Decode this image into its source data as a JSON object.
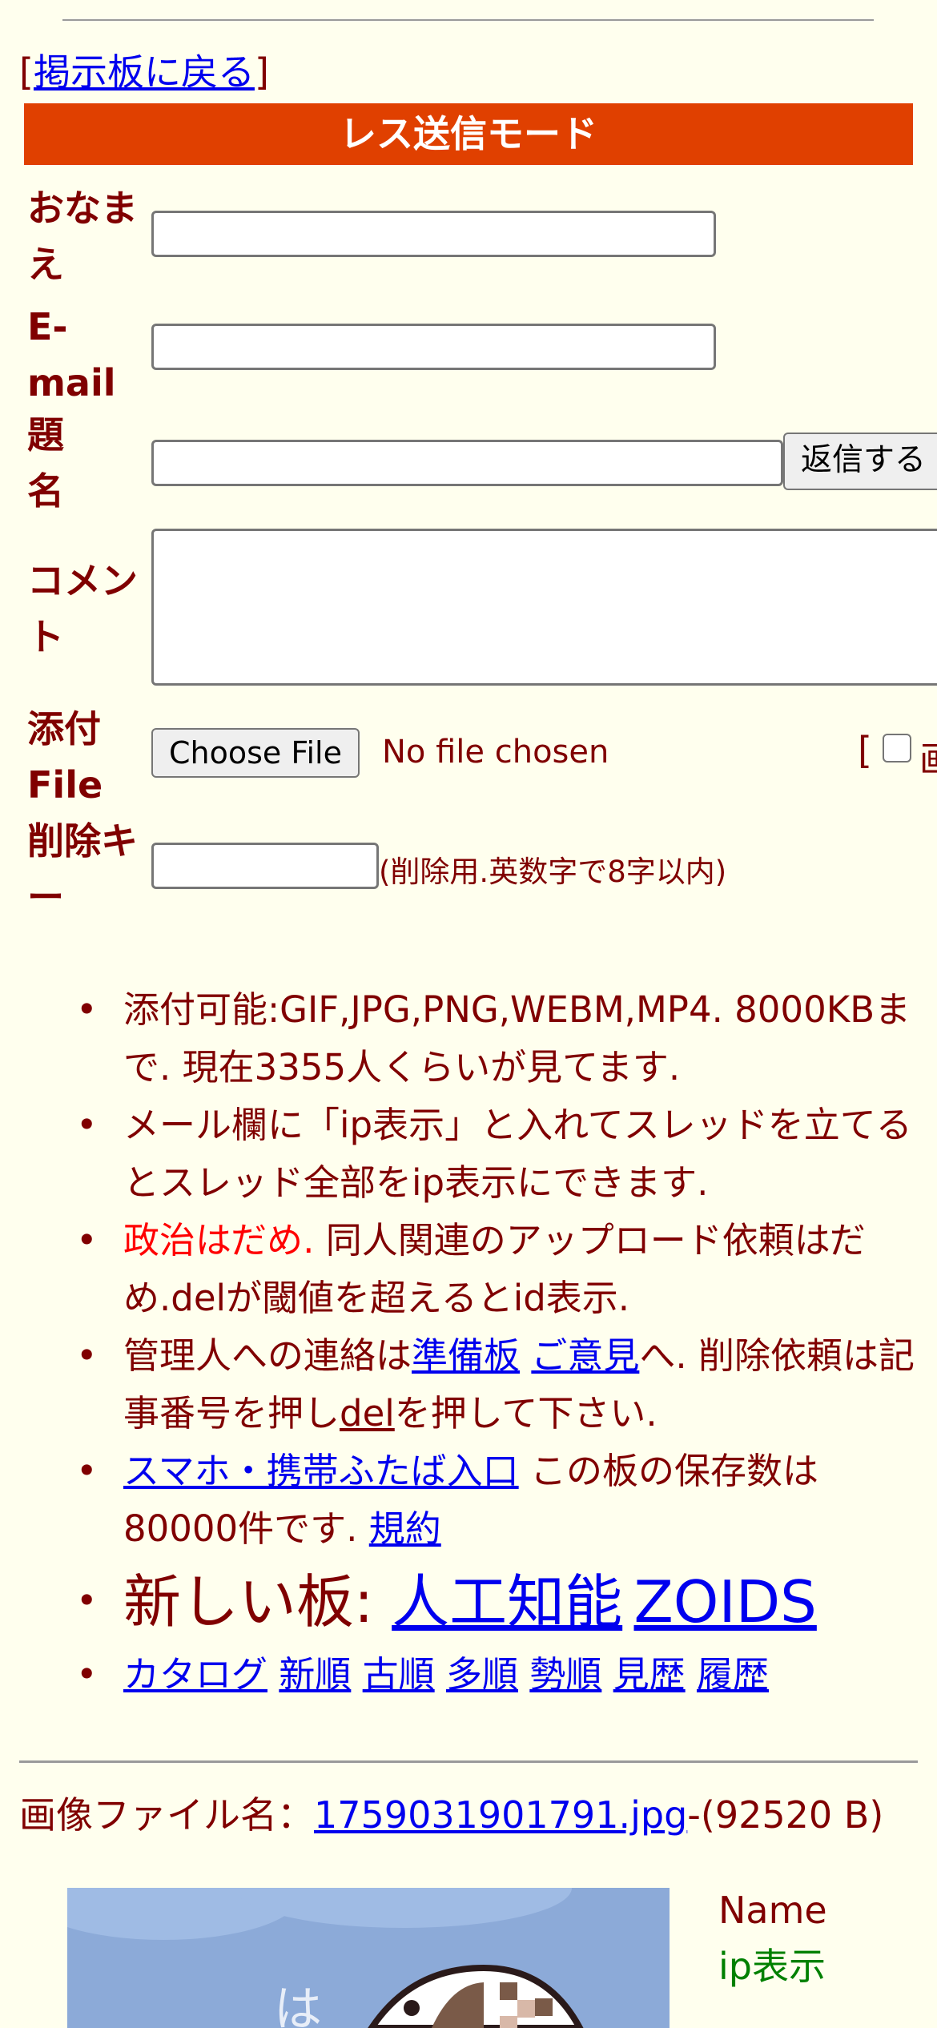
{
  "nav": {
    "bracket_open": "[",
    "back_link": "掲示板に戻る",
    "bracket_close": "]"
  },
  "form": {
    "title": "レス送信モード",
    "name_label": "おなまえ",
    "email_label": "E-mail",
    "subject_label": "題名",
    "comment_label": "コメント",
    "file_label": "添付File",
    "delkey_label": "削除キー",
    "submit_label": "返信する",
    "choose_file_label": "Choose File",
    "no_file_text": "No file chosen",
    "extra_bracket": "[",
    "extra_label_partial": "画",
    "delkey_note": "(削除用.英数字で8字以内)"
  },
  "rules": {
    "r1": "添付可能:GIF,JPG,PNG,WEBM,MP4. 8000KBまで. 現在3355人くらいが見てます.",
    "r2": "メール欄に「ip表示」と入れてスレッドを立てるとスレッド全部をip表示にできます.",
    "r3_red": "政治はだめ.",
    "r3_rest": " 同人関連のアップロード依頼はだめ.delが閾値を超えるとid表示.",
    "r4_a": "管理人への連絡は",
    "r4_link1": "準備板",
    "r4_link2": "ご意見",
    "r4_b": "へ. 削除依頼は記事番号を押し",
    "r4_del": "del",
    "r4_c": "を押して下さい.",
    "r5_link": "スマホ・携帯ふたば入口",
    "r5_text": " この板の保存数は80000件です. ",
    "r5_link2": "規約",
    "r6_text": "新しい板: ",
    "r6_link1": "人工知能",
    "r6_link2": "ZOIDS",
    "nav_links": [
      "カタログ",
      "新順",
      "古順",
      "多順",
      "勢順",
      "見歴",
      "履歴"
    ]
  },
  "post": {
    "file_label": "画像ファイル名：",
    "file_name": "1759031901791.jpg",
    "file_size": "-(92520 B)",
    "name_text": "Name",
    "ip_text": "ip表示"
  },
  "colors": {
    "background": "#ffffee",
    "text": "#800000",
    "banner": "#e04000",
    "link": "#0000ee",
    "ip": "#008000"
  }
}
